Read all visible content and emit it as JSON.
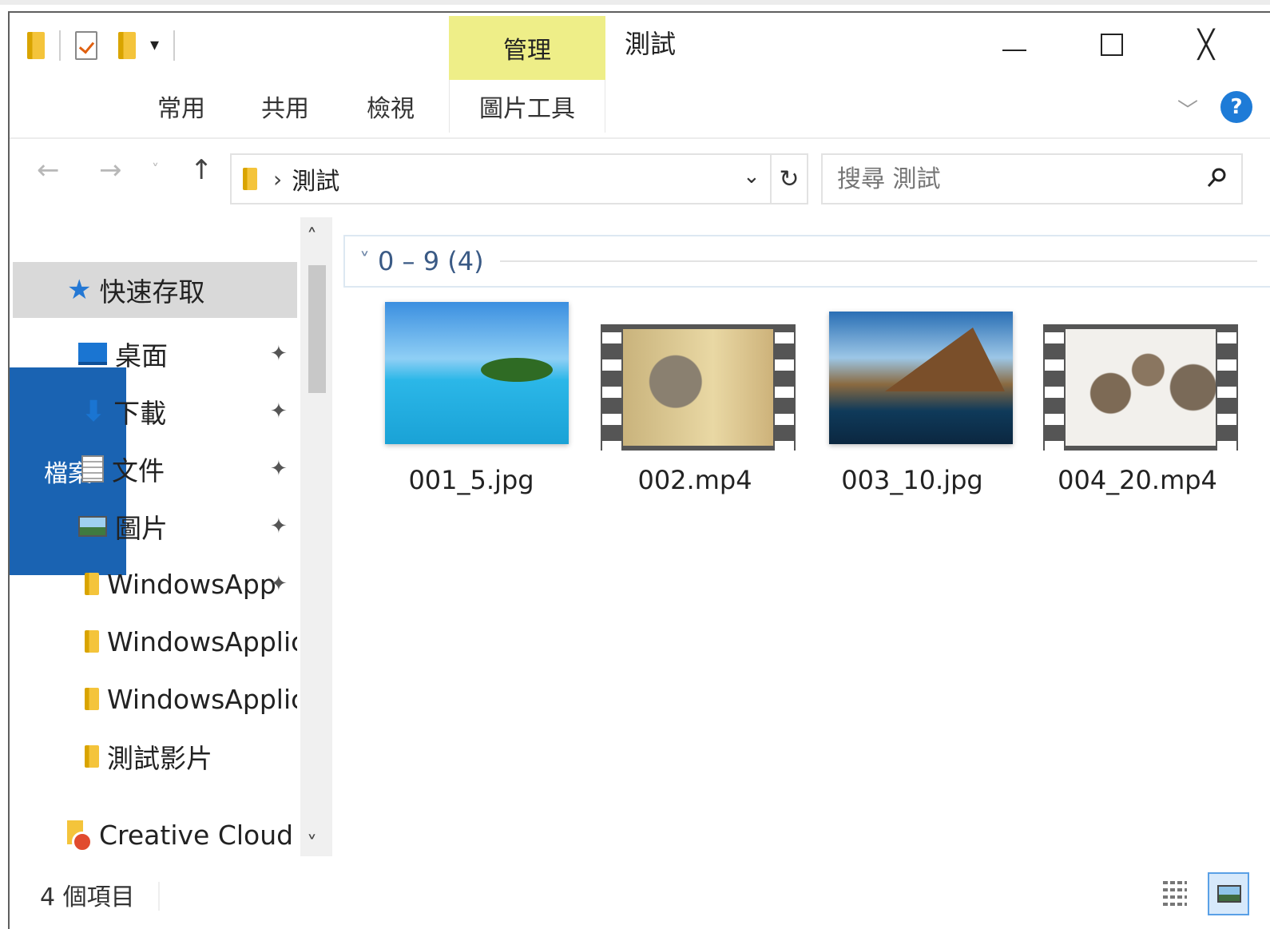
{
  "titlebar": {
    "qat_dropdown": "▾",
    "manage_tab": "管理",
    "window_title": "測試",
    "minimize_icon": "minimize-icon",
    "maximize_icon": "maximize-icon",
    "close_glyph": "╳"
  },
  "ribbon": {
    "tabs": [
      {
        "label": "檔案"
      },
      {
        "label": "常用"
      },
      {
        "label": "共用"
      },
      {
        "label": "檢視"
      },
      {
        "label": "圖片工具"
      }
    ],
    "expand_glyph": "﹀",
    "help_label": "?"
  },
  "nav": {
    "back": "←",
    "forward": "→",
    "recent": "˅",
    "up": "↑",
    "separator": "›",
    "path": "測試",
    "dropdown": "⌄",
    "refresh": "↻",
    "search_placeholder": "搜尋 測試"
  },
  "sidebar": {
    "quick_access": "快速存取",
    "items": [
      {
        "label": "桌面",
        "icon": "desktop-icon",
        "pinned": true
      },
      {
        "label": "下載",
        "icon": "download-icon",
        "pinned": true
      },
      {
        "label": "文件",
        "icon": "document-icon",
        "pinned": true
      },
      {
        "label": "圖片",
        "icon": "picture-icon",
        "pinned": true
      },
      {
        "label": "WindowsApp",
        "icon": "folder-icon",
        "pinned": true
      },
      {
        "label": "WindowsApplic",
        "icon": "folder-icon",
        "pinned": false
      },
      {
        "label": "WindowsApplic",
        "icon": "folder-icon",
        "pinned": false
      },
      {
        "label": "測試影片",
        "icon": "folder-icon",
        "pinned": false
      }
    ],
    "creative_cloud": "Creative Cloud Fi",
    "pin_glyph": "✦",
    "scroll_up": "˄",
    "scroll_down": "˅"
  },
  "content": {
    "group_chevron": "˅",
    "group_label": "0 – 9 (4)",
    "files": [
      {
        "name": "001_5.jpg",
        "type": "image"
      },
      {
        "name": "002.mp4",
        "type": "video"
      },
      {
        "name": "003_10.jpg",
        "type": "image"
      },
      {
        "name": "004_20.mp4",
        "type": "video"
      }
    ]
  },
  "status": {
    "count": "4 個項目"
  },
  "colors": {
    "file_tab": "#1a63b2",
    "manage_tab": "#eeee88",
    "help": "#1e7bd7",
    "quick_access_bg": "#d9d9d9"
  }
}
